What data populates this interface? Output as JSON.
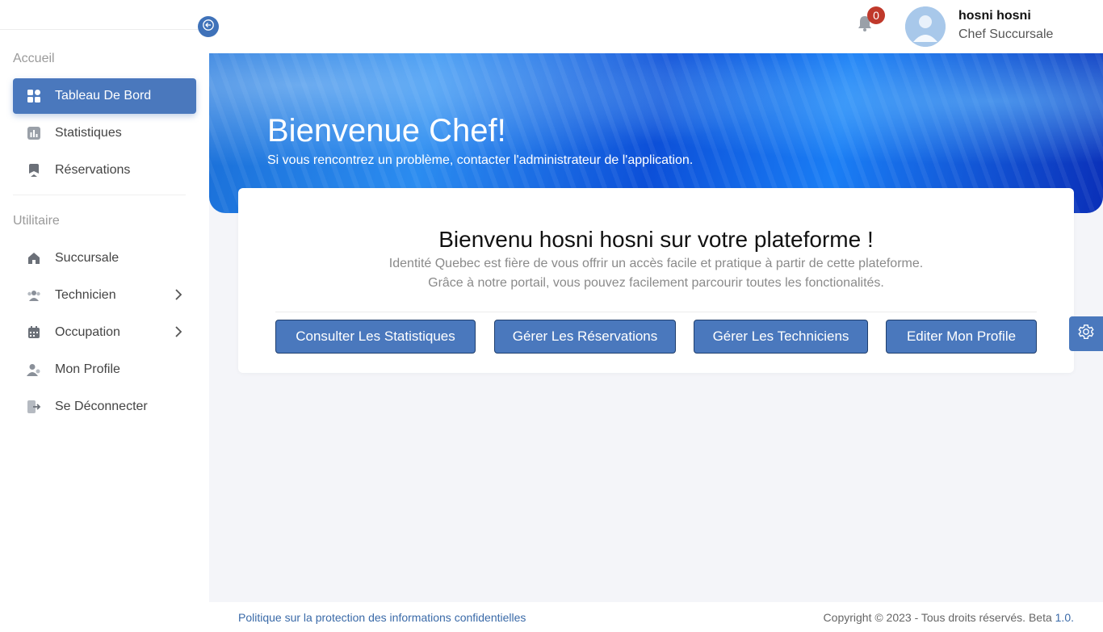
{
  "sidebar": {
    "sections": [
      {
        "title": "Accueil",
        "items": [
          {
            "label": "Tableau De Bord",
            "icon": "grid-icon",
            "active": true
          },
          {
            "label": "Statistiques",
            "icon": "chart-icon"
          },
          {
            "label": "Réservations",
            "icon": "bookmark-icon"
          }
        ]
      },
      {
        "title": "Utilitaire",
        "items": [
          {
            "label": "Succursale",
            "icon": "home-icon"
          },
          {
            "label": "Technicien",
            "icon": "users-icon",
            "has_submenu": true
          },
          {
            "label": "Occupation",
            "icon": "calendar-icon",
            "has_submenu": true
          },
          {
            "label": "Mon Profile",
            "icon": "user-profile-icon"
          },
          {
            "label": "Se Déconnecter",
            "icon": "logout-icon"
          }
        ]
      }
    ]
  },
  "header": {
    "notifications_count": "0",
    "user_name": "hosni hosni",
    "user_role": "Chef Succursale"
  },
  "hero": {
    "title": "Bienvenue Chef!",
    "subtitle": "Si vous rencontrez un problème, contacter l'administrateur de l'application."
  },
  "welcome_card": {
    "title": "Bienvenu hosni hosni sur votre plateforme !",
    "line1": "Identité Quebec est fière de vous offrir un accès facile et pratique à partir de cette plateforme.",
    "line2": "Grâce à notre portail, vous pouvez facilement parcourir toutes les fonctionalités.",
    "buttons": [
      "Consulter Les Statistiques",
      "Gérer Les Réservations",
      "Gérer Les Techniciens",
      "Editer Mon Profile"
    ]
  },
  "footer": {
    "privacy_link": "Politique sur la protection des informations confidentielles",
    "copyright": "Copyright © 2023 - Tous droits réservés. Beta ",
    "version": "1.0."
  },
  "colors": {
    "accent": "#4a78bd",
    "badge": "#c0392b"
  }
}
